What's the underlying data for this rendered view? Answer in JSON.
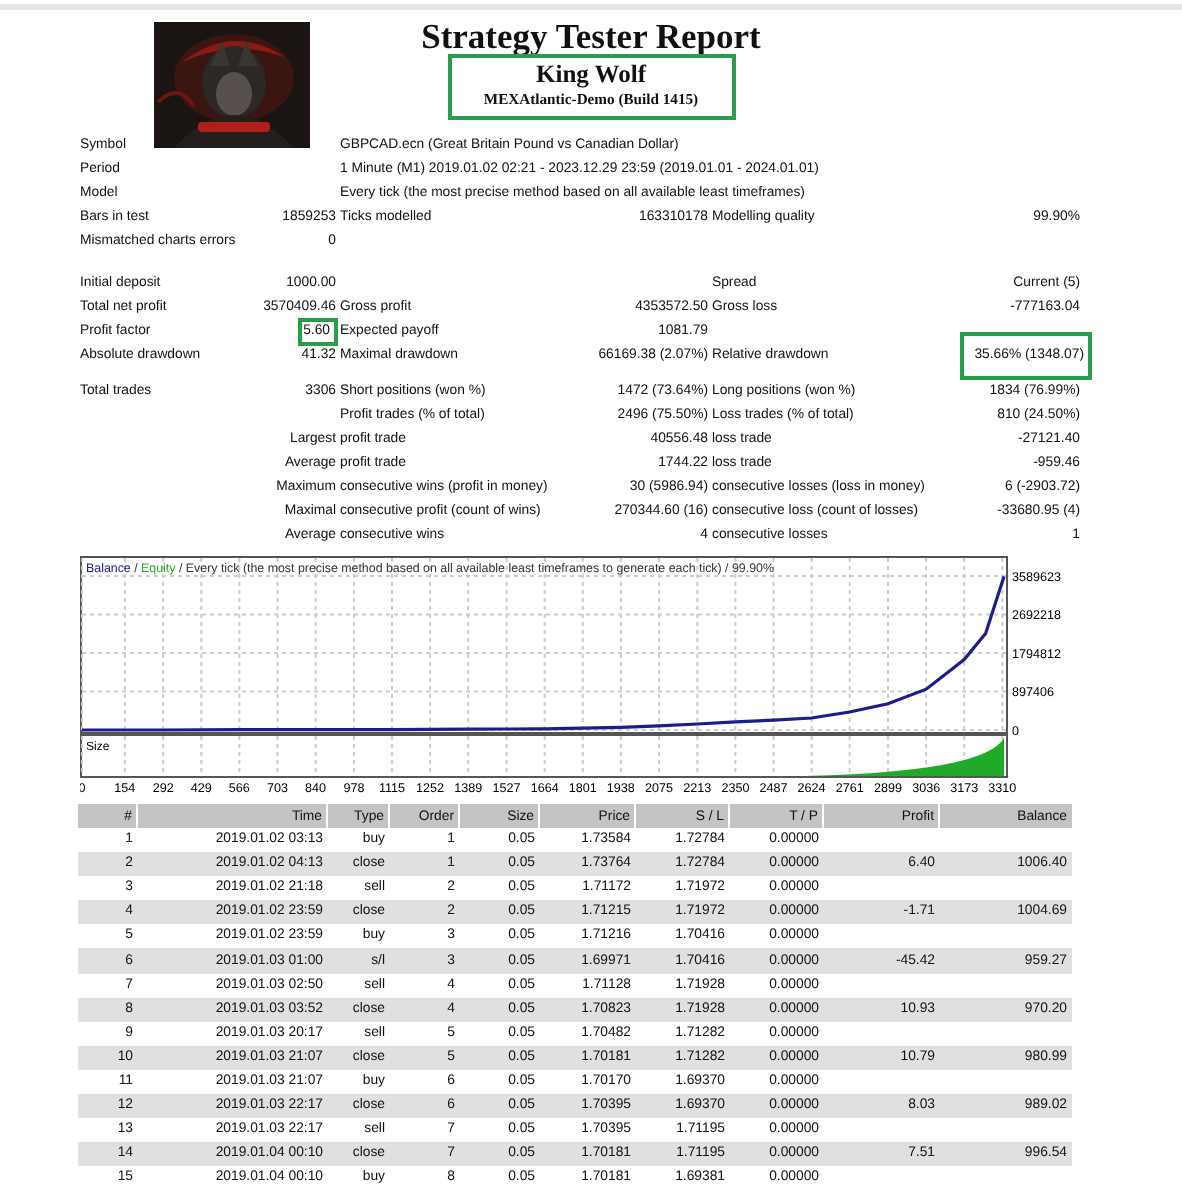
{
  "header": {
    "title": "Strategy Tester Report",
    "expert": "King Wolf",
    "server": "MEXAtlantic-Demo (Build 1415)",
    "highlighted": true
  },
  "stats": {
    "sections": [
      {
        "rows": [
          {
            "kind": "wide",
            "label": "Symbol",
            "text": "GBPCAD.ecn (Great Britain Pound vs Canadian Dollar)"
          },
          {
            "kind": "wide",
            "label": "Period",
            "text": "1 Minute (M1) 2019.01.02 02:21 - 2023.12.29 23:59 (2019.01.01 - 2024.01.01)"
          },
          {
            "kind": "wide",
            "label": "Model",
            "text": "Every tick (the most precise method based on all available least timeframes)"
          },
          {
            "kind": "pairs",
            "label": "Bars in test",
            "value": "1859253",
            "label_2": "Ticks modelled",
            "value_2": "163310178",
            "label_3": "Modelling quality",
            "value_3": "99.90%"
          },
          {
            "kind": "pairs",
            "label": "Mismatched charts errors",
            "value": "0"
          }
        ]
      },
      {
        "rows": [
          {
            "kind": "pairs",
            "label": "Initial deposit",
            "value": "1000.00",
            "label_3": "Spread",
            "value_3": "Current (5)"
          },
          {
            "kind": "pairs",
            "label": "Total net profit",
            "value": "3570409.46",
            "label_2": "Gross profit",
            "value_2": "4353572.50",
            "label_3": "Gross loss",
            "value_3": "-777163.04"
          },
          {
            "kind": "pairs",
            "label": "Profit factor",
            "value": "5.60",
            "value_highlighted": true,
            "label_2": "Expected payoff",
            "value_2": "1081.79"
          },
          {
            "kind": "pairs",
            "label": "Absolute drawdown",
            "value": "41.32",
            "label_2": "Maximal drawdown",
            "value_2": "66169.38 (2.07%)",
            "label_3": "Relative drawdown",
            "value_3": "35.66% (1348.07)",
            "value_3_highlighted": true
          }
        ]
      },
      {
        "rows": [
          {
            "kind": "pairs",
            "label": "Total trades",
            "value": "3306",
            "label_2": "Short positions (won %)",
            "value_2": "1472 (73.64%)",
            "label_3": "Long positions (won %)",
            "value_3": "1834 (76.99%)"
          },
          {
            "kind": "pairs",
            "label_2": "Profit trades (% of total)",
            "value_2": "2496 (75.50%)",
            "label_3": "Loss trades (% of total)",
            "value_3": "810 (24.50%)"
          },
          {
            "kind": "sub",
            "label": "Largest",
            "label_2": "profit trade",
            "value_2": "40556.48",
            "label_3": "loss trade",
            "value_3": "-27121.40"
          },
          {
            "kind": "sub",
            "label": "Average",
            "label_2": "profit trade",
            "value_2": "1744.22",
            "label_3": "loss trade",
            "value_3": "-959.46"
          },
          {
            "kind": "sub",
            "label": "Maximum",
            "label_2": "consecutive wins (profit in money)",
            "value_2": "30 (5986.94)",
            "label_3": "consecutive losses (loss in money)",
            "value_3": "6 (-2903.72)"
          },
          {
            "kind": "sub",
            "label": "Maximal",
            "label_2": "consecutive profit (count of wins)",
            "value_2": "270344.60 (16)",
            "label_3": "consecutive loss (count of losses)",
            "value_3": "-33680.95 (4)"
          },
          {
            "kind": "sub",
            "label": "Average",
            "label_2": "consecutive wins",
            "value_2": "4",
            "label_3": "consecutive losses",
            "value_3": "1"
          }
        ]
      }
    ]
  },
  "chart": {
    "legend": [
      {
        "text": " / "
      },
      {
        "text": "Equity",
        "color": "#22aa22"
      },
      {
        "text": " / Every tick (the most precise method based on all available least timeframes to generate each tick) / 99.90%"
      }
    ],
    "size_label": "Size",
    "chart_data": {
      "type": "line",
      "grid": true,
      "x": [
        0,
        292,
        566,
        840,
        1115,
        1389,
        1664,
        1801,
        1938,
        2075,
        2213,
        2350,
        2487,
        2624,
        2761,
        2899,
        3036,
        3173,
        3250,
        3316
      ],
      "series": [
        {
          "name": "Balance",
          "color": "#1c1c8c",
          "values": [
            0,
            0,
            10000,
            10000,
            10000,
            20000,
            30000,
            40000,
            60000,
            100000,
            140000,
            190000,
            230000,
            280000,
            420000,
            610000,
            950000,
            1640000,
            2250000,
            3580000
          ]
        }
      ],
      "xlim": [
        0,
        3316
      ],
      "ylim": [
        0,
        3589623
      ],
      "xticks": [
        0,
        154,
        292,
        429,
        566,
        703,
        840,
        978,
        1115,
        1252,
        1389,
        1527,
        1664,
        1801,
        1938,
        2075,
        2213,
        2350,
        2487,
        2624,
        2761,
        2899,
        3036,
        3173,
        3310
      ],
      "yticks": [
        0,
        897406,
        1794812,
        2692218,
        3589623
      ]
    }
  },
  "deals": {
    "columns": [
      "#",
      "Time",
      "Type",
      "Order",
      "Size",
      "Price",
      "S / L",
      "T / P",
      "Profit",
      "Balance"
    ],
    "rows": [
      [
        "1",
        "2019.01.02 03:13",
        "buy",
        "1",
        "0.05",
        "1.73584",
        "1.72784",
        "0.00000"
      ],
      [
        "2",
        "2019.01.02 04:13",
        "close",
        "1",
        "0.05",
        "1.73764",
        "1.72784",
        "0.00000",
        "6.40",
        "1006.40"
      ],
      [
        "3",
        "2019.01.02 21:18",
        "sell",
        "2",
        "0.05",
        "1.71172",
        "1.71972",
        "0.00000"
      ],
      [
        "4",
        "2019.01.02 23:59",
        "close",
        "2",
        "0.05",
        "1.71215",
        "1.71972",
        "0.00000",
        "-1.71",
        "1004.69"
      ],
      [
        "5",
        "2019.01.02 23:59",
        "buy",
        "3",
        "0.05",
        "1.71216",
        "1.70416",
        "0.00000"
      ],
      [
        "6",
        "2019.01.03 01:00",
        "s/l",
        "3",
        "0.05",
        "1.69971",
        "1.70416",
        "0.00000",
        "-45.42",
        "959.27"
      ],
      [
        "7",
        "2019.01.03 02:50",
        "sell",
        "4",
        "0.05",
        "1.71128",
        "1.71928",
        "0.00000"
      ],
      [
        "8",
        "2019.01.03 03:52",
        "close",
        "4",
        "0.05",
        "1.70823",
        "1.71928",
        "0.00000",
        "10.93",
        "970.20"
      ],
      [
        "9",
        "2019.01.03 20:17",
        "sell",
        "5",
        "0.05",
        "1.70482",
        "1.71282",
        "0.00000"
      ],
      [
        "10",
        "2019.01.03 21:07",
        "close",
        "5",
        "0.05",
        "1.70181",
        "1.71282",
        "0.00000",
        "10.79",
        "980.99"
      ],
      [
        "11",
        "2019.01.03 21:07",
        "buy",
        "6",
        "0.05",
        "1.70170",
        "1.69370",
        "0.00000"
      ],
      [
        "12",
        "2019.01.03 22:17",
        "close",
        "6",
        "0.05",
        "1.70395",
        "1.69370",
        "0.00000",
        "8.03",
        "989.02"
      ],
      [
        "13",
        "2019.01.03 22:17",
        "sell",
        "7",
        "0.05",
        "1.70395",
        "1.71195",
        "0.00000"
      ],
      [
        "14",
        "2019.01.04 00:10",
        "close",
        "7",
        "0.05",
        "1.70181",
        "1.71195",
        "0.00000",
        "7.51",
        "996.54"
      ],
      [
        "15",
        "2019.01.04 00:10",
        "buy",
        "8",
        "0.05",
        "1.70181",
        "1.69381",
        "0.00000"
      ]
    ]
  }
}
